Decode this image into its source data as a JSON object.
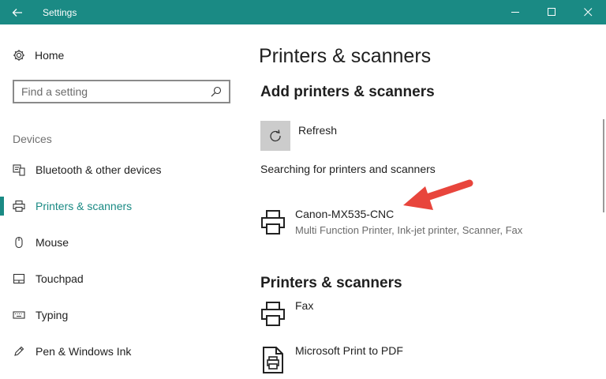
{
  "window": {
    "title": "Settings",
    "accent_color": "#1a8a84",
    "icons": {
      "back": "back-arrow-icon",
      "minimize": "minimize-icon",
      "maximize": "maximize-icon",
      "close": "close-icon"
    }
  },
  "sidebar": {
    "home_label": "Home",
    "search_placeholder": "Find a setting",
    "section_label": "Devices",
    "items": [
      {
        "label": "Bluetooth & other devices",
        "icon": "bluetooth-devices-icon",
        "active": false
      },
      {
        "label": "Printers & scanners",
        "icon": "printer-icon",
        "active": true
      },
      {
        "label": "Mouse",
        "icon": "mouse-icon",
        "active": false
      },
      {
        "label": "Touchpad",
        "icon": "touchpad-icon",
        "active": false
      },
      {
        "label": "Typing",
        "icon": "keyboard-icon",
        "active": false
      },
      {
        "label": "Pen & Windows Ink",
        "icon": "pen-icon",
        "active": false
      }
    ]
  },
  "main": {
    "page_title": "Printers & scanners",
    "add_heading": "Add printers & scanners",
    "refresh_label": "Refresh",
    "searching_text": "Searching for printers and scanners",
    "found_devices": [
      {
        "name": "Canon-MX535-CNC",
        "description": "Multi Function Printer, Ink-jet printer, Scanner, Fax",
        "icon": "printer-icon"
      }
    ],
    "installed_heading": "Printers & scanners",
    "installed_devices": [
      {
        "name": "Fax",
        "icon": "printer-icon"
      },
      {
        "name": "Microsoft Print to PDF",
        "icon": "pdf-printer-icon"
      }
    ]
  },
  "annotation": {
    "arrow_color": "#e8453c",
    "icon": "red-arrow-icon"
  }
}
